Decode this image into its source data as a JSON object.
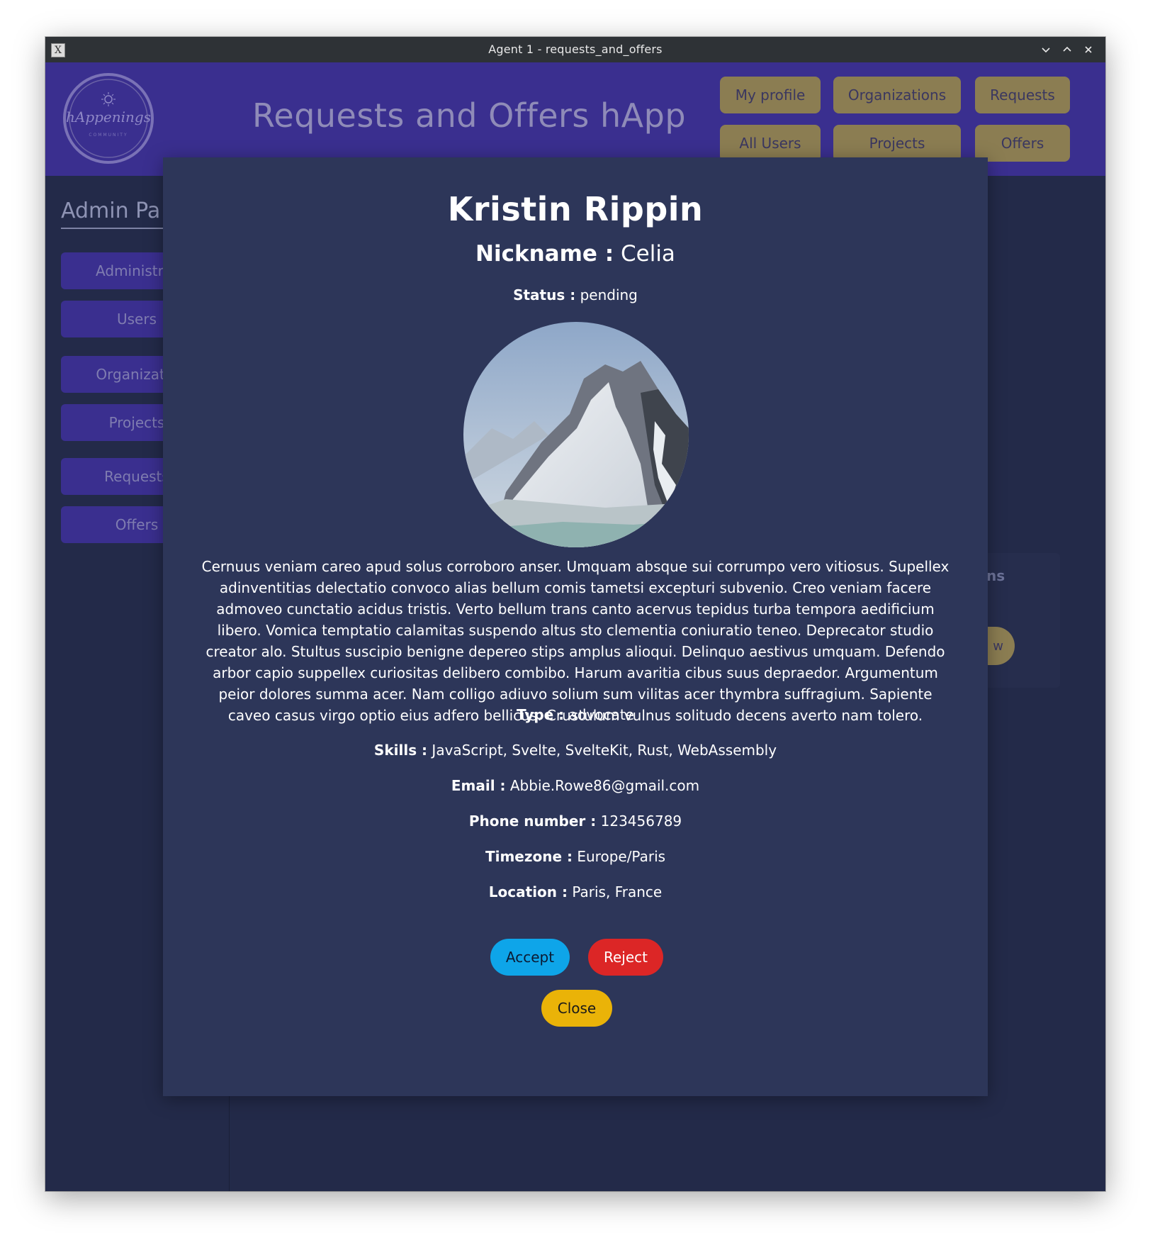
{
  "window": {
    "title": "Agent 1 - requests_and_offers",
    "app_icon": "x-app-icon",
    "controls": [
      "minimize-icon",
      "maximize-icon",
      "close-icon"
    ]
  },
  "header": {
    "app_title": "Requests and Offers hApp",
    "logo_text": "hAppenings",
    "logo_sub": "COMMUNITY",
    "nav": {
      "my_profile": "My profile",
      "organizations": "Organizations",
      "requests": "Requests",
      "all_users": "All Users",
      "projects": "Projects",
      "offers": "Offers"
    }
  },
  "sidebar": {
    "title": "Admin Pa",
    "items": [
      "Administrat",
      "Users",
      "Organizatio",
      "Projects",
      "Requests",
      "Offers"
    ]
  },
  "background": {
    "card_text": "ns",
    "card_button": "w"
  },
  "modal": {
    "name": "Kristin Rippin",
    "nickname_label": "Nickname :",
    "nickname": "Celia",
    "status_label": "Status :",
    "status": "pending",
    "bio": "Cernuus veniam careo apud solus corroboro anser. Umquam absque sui corrumpo vero vitiosus. Supellex adinventitias delectatio convoco alias bellum comis tametsi excepturi subvenio. Creo veniam facere admoveo cunctatio acidus tristis. Verto bellum trans canto acervus tepidus turba tempora aedificium libero. Vomica temptatio calamitas suspendo altus sto clementia coniuratio teneo. Deprecator studio creator alo. Stultus suscipio benigne depereo stips amplus alioqui. Delinquo aestivus umquam. Defendo arbor capio suppellex curiositas delibero combibo. Harum avaritia cibus suus depraedor. Argumentum peior dolores summa acer. Nam colligo adiuvo solium sum vilitas acer thymbra suffragium. Sapiente caveo casus virgo optio eius adfero bellicus. Crustulum vulnus solitudo decens averto nam tolero.",
    "type_label": "Type :",
    "type": "advocate",
    "skills_label": "Skills :",
    "skills": "JavaScript, Svelte, SvelteKit, Rust, WebAssembly",
    "email_label": "Email :",
    "email": "Abbie.Rowe86@gmail.com",
    "phone_label": "Phone number :",
    "phone": "123456789",
    "timezone_label": "Timezone :",
    "timezone": "Europe/Paris",
    "location_label": "Location :",
    "location": "Paris, France",
    "accept_label": "Accept",
    "reject_label": "Reject",
    "close_label": "Close",
    "avatar_icon": "mountain-avatar-image"
  },
  "colors": {
    "header_bg": "#3a2f8f",
    "app_bg": "#232a49",
    "modal_bg": "#2d3659",
    "accept": "#0ea5e9",
    "reject": "#dc2626",
    "close": "#eab308",
    "nav_button": "#8b7d52"
  }
}
